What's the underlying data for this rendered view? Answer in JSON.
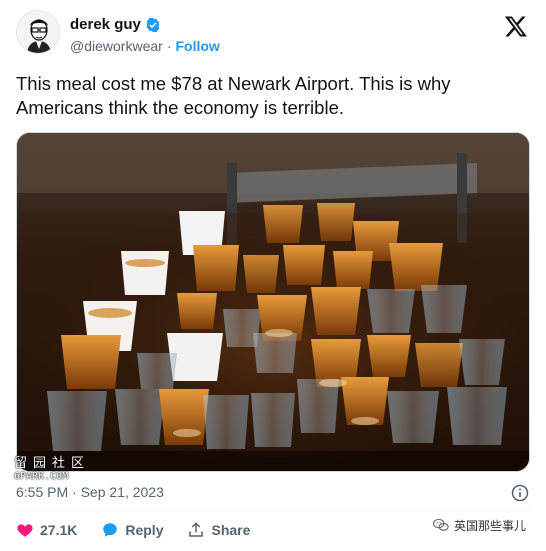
{
  "user": {
    "display_name": "derek guy",
    "handle": "@dieworkwear",
    "separator": "·",
    "follow_label": "Follow",
    "verified_color": "#1d9bf0"
  },
  "tweet": {
    "text": "This meal cost me $78 at Newark Airport. This is why Americans think the economy is terrible."
  },
  "meta": {
    "timestamp": "6:55 PM · Sep 21, 2023"
  },
  "actions": {
    "like_count": "27.1K",
    "reply_label": "Reply",
    "share_label": "Share"
  },
  "watermarks": {
    "left_cn": "留园社区",
    "left_en": "6PARK.COM",
    "right_cn": "英国那些事儿"
  },
  "colors": {
    "like": "#f91880",
    "reply": "#1d9bf0",
    "link": "#1d9bf0",
    "secondary_text": "#536471"
  }
}
